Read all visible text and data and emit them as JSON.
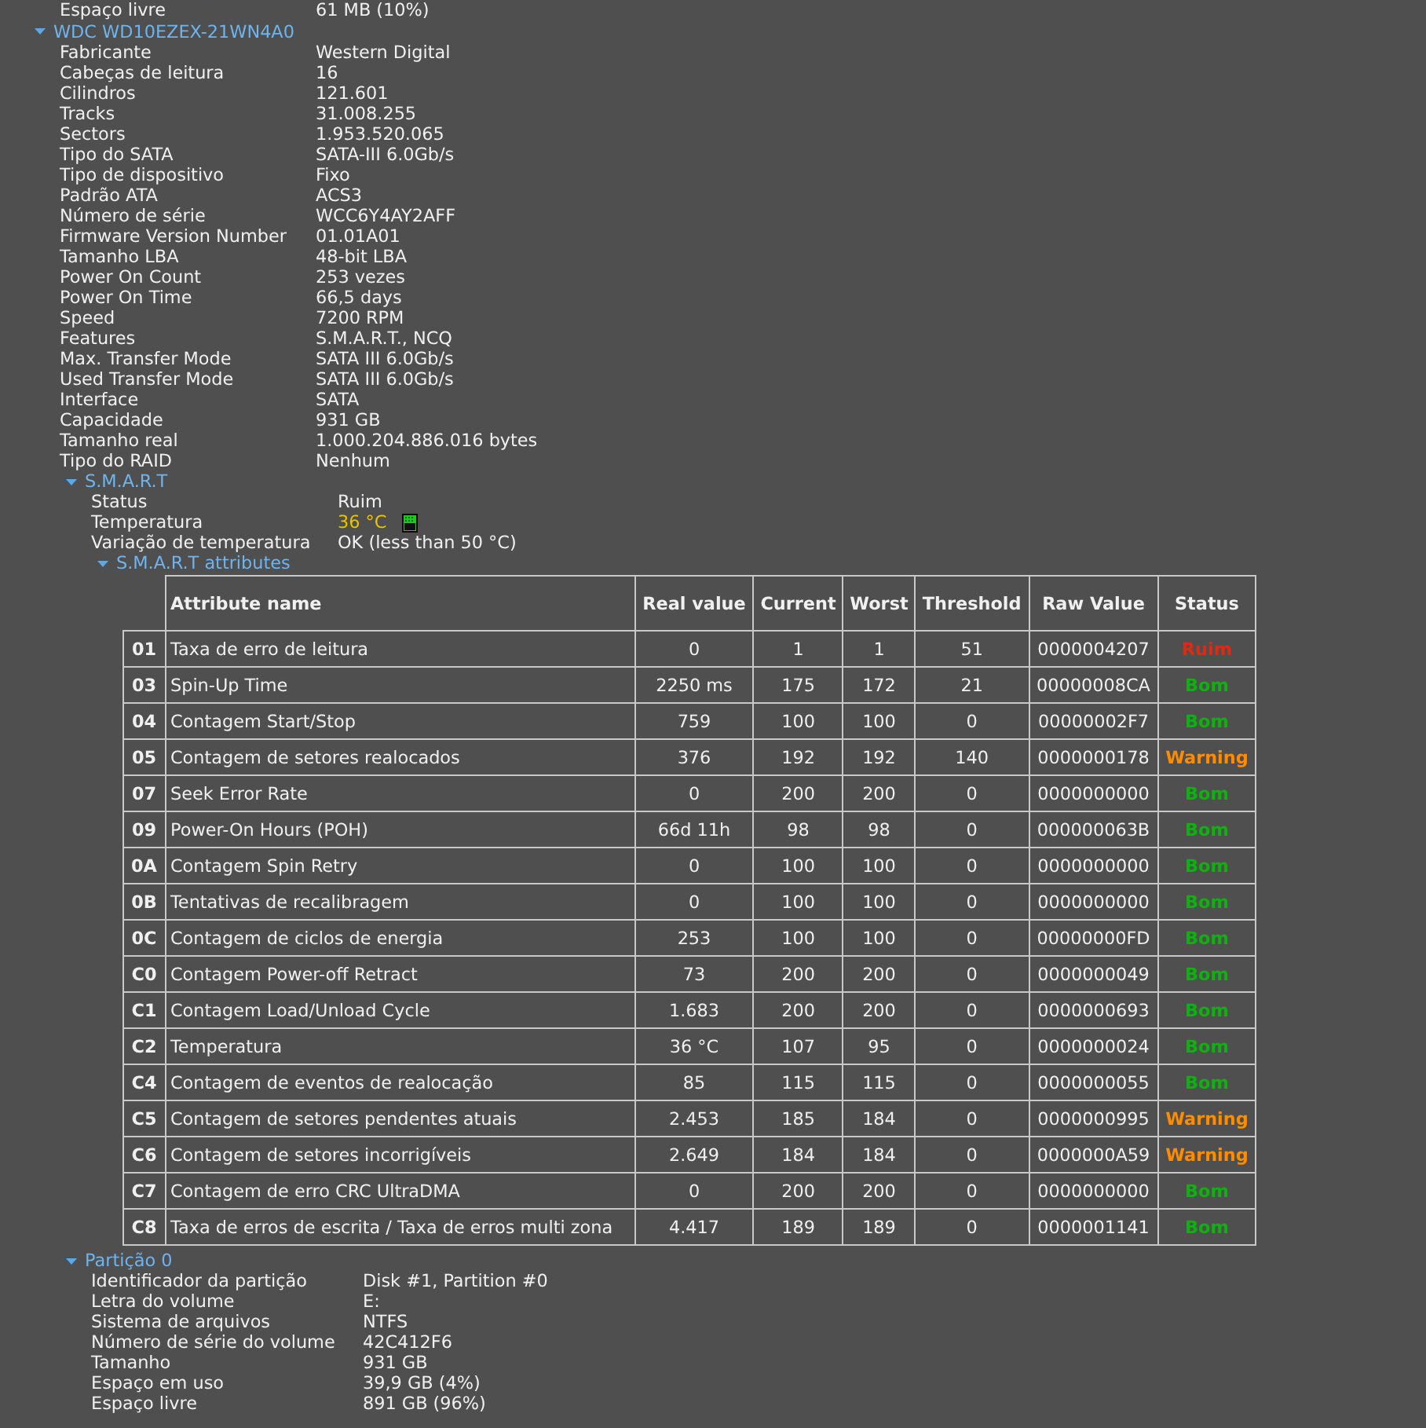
{
  "cut_row": {
    "label": "Espaço livre",
    "value": "61 MB (10%)"
  },
  "disk": {
    "title": "WDC WD10EZEX-21WN4A0",
    "expanded": true,
    "properties": [
      {
        "label": "Fabricante",
        "value": "Western Digital"
      },
      {
        "label": "Cabeças de leitura",
        "value": "16"
      },
      {
        "label": "Cilindros",
        "value": "121.601"
      },
      {
        "label": "Tracks",
        "value": "31.008.255"
      },
      {
        "label": "Sectors",
        "value": "1.953.520.065"
      },
      {
        "label": "Tipo do SATA",
        "value": "SATA-III 6.0Gb/s"
      },
      {
        "label": "Tipo de dispositivo",
        "value": "Fixo"
      },
      {
        "label": "Padrão ATA",
        "value": "ACS3"
      },
      {
        "label": "Número de série",
        "value": "WCC6Y4AY2AFF"
      },
      {
        "label": "Firmware Version Number",
        "value": "01.01A01"
      },
      {
        "label": "Tamanho LBA",
        "value": "48-bit LBA"
      },
      {
        "label": "Power On Count",
        "value": "253 vezes"
      },
      {
        "label": "Power On Time",
        "value": "66,5 days"
      },
      {
        "label": "Speed",
        "value": "7200 RPM"
      },
      {
        "label": "Features",
        "value": "S.M.A.R.T., NCQ"
      },
      {
        "label": "Max. Transfer Mode",
        "value": "SATA III 6.0Gb/s"
      },
      {
        "label": "Used Transfer Mode",
        "value": "SATA III 6.0Gb/s"
      },
      {
        "label": "Interface",
        "value": "SATA"
      },
      {
        "label": "Capacidade",
        "value": "931 GB"
      },
      {
        "label": "Tamanho real",
        "value": "1.000.204.886.016 bytes"
      },
      {
        "label": "Tipo do RAID",
        "value": "Nenhum"
      }
    ]
  },
  "smart": {
    "title": "S.M.A.R.T",
    "expanded": true,
    "items": [
      {
        "label": "Status",
        "value": "Ruim",
        "kind": "text"
      },
      {
        "label": "Temperatura",
        "value": "36 °C",
        "kind": "temperature",
        "color": "#e8c400"
      },
      {
        "label": "Variação de temperatura",
        "value": "OK (less than 50 °C)",
        "kind": "text"
      }
    ],
    "attributes": {
      "title": "S.M.A.R.T attributes",
      "expanded": true,
      "columns": [
        "Attribute name",
        "Real value",
        "Current",
        "Worst",
        "Threshold",
        "Raw Value",
        "Status"
      ],
      "rows": [
        {
          "id": "01",
          "name": "Taxa de erro de leitura",
          "real": "0",
          "current": "1",
          "worst": "1",
          "threshold": "51",
          "raw": "0000004207",
          "status": "Ruim",
          "color": "#e02a10"
        },
        {
          "id": "03",
          "name": "Spin-Up Time",
          "real": "2250 ms",
          "current": "175",
          "worst": "172",
          "threshold": "21",
          "raw": "00000008CA",
          "status": "Bom",
          "color": "#10b010"
        },
        {
          "id": "04",
          "name": "Contagem Start/Stop",
          "real": "759",
          "current": "100",
          "worst": "100",
          "threshold": "0",
          "raw": "00000002F7",
          "status": "Bom",
          "color": "#10b010"
        },
        {
          "id": "05",
          "name": "Contagem de setores realocados",
          "real": "376",
          "current": "192",
          "worst": "192",
          "threshold": "140",
          "raw": "0000000178",
          "status": "Warning",
          "color": "#ff8c00"
        },
        {
          "id": "07",
          "name": "Seek Error Rate",
          "real": "0",
          "current": "200",
          "worst": "200",
          "threshold": "0",
          "raw": "0000000000",
          "status": "Bom",
          "color": "#10b010"
        },
        {
          "id": "09",
          "name": "Power-On Hours (POH)",
          "real": "66d 11h",
          "current": "98",
          "worst": "98",
          "threshold": "0",
          "raw": "000000063B",
          "status": "Bom",
          "color": "#10b010"
        },
        {
          "id": "0A",
          "name": "Contagem Spin Retry",
          "real": "0",
          "current": "100",
          "worst": "100",
          "threshold": "0",
          "raw": "0000000000",
          "status": "Bom",
          "color": "#10b010"
        },
        {
          "id": "0B",
          "name": "Tentativas de recalibragem",
          "real": "0",
          "current": "100",
          "worst": "100",
          "threshold": "0",
          "raw": "0000000000",
          "status": "Bom",
          "color": "#10b010"
        },
        {
          "id": "0C",
          "name": "Contagem de ciclos de energia",
          "real": "253",
          "current": "100",
          "worst": "100",
          "threshold": "0",
          "raw": "00000000FD",
          "status": "Bom",
          "color": "#10b010"
        },
        {
          "id": "C0",
          "name": "Contagem Power-off Retract",
          "real": "73",
          "current": "200",
          "worst": "200",
          "threshold": "0",
          "raw": "0000000049",
          "status": "Bom",
          "color": "#10b010"
        },
        {
          "id": "C1",
          "name": "Contagem Load/Unload Cycle",
          "real": "1.683",
          "current": "200",
          "worst": "200",
          "threshold": "0",
          "raw": "0000000693",
          "status": "Bom",
          "color": "#10b010"
        },
        {
          "id": "C2",
          "name": "Temperatura",
          "real": "36 °C",
          "current": "107",
          "worst": "95",
          "threshold": "0",
          "raw": "0000000024",
          "status": "Bom",
          "color": "#10b010"
        },
        {
          "id": "C4",
          "name": "Contagem de eventos de realocação",
          "real": "85",
          "current": "115",
          "worst": "115",
          "threshold": "0",
          "raw": "0000000055",
          "status": "Bom",
          "color": "#10b010"
        },
        {
          "id": "C5",
          "name": "Contagem de setores pendentes atuais",
          "real": "2.453",
          "current": "185",
          "worst": "184",
          "threshold": "0",
          "raw": "0000000995",
          "status": "Warning",
          "color": "#ff8c00"
        },
        {
          "id": "C6",
          "name": "Contagem de setores incorrigíveis",
          "real": "2.649",
          "current": "184",
          "worst": "184",
          "threshold": "0",
          "raw": "0000000A59",
          "status": "Warning",
          "color": "#ff8c00"
        },
        {
          "id": "C7",
          "name": "Contagem de erro CRC UltraDMA",
          "real": "0",
          "current": "200",
          "worst": "200",
          "threshold": "0",
          "raw": "0000000000",
          "status": "Bom",
          "color": "#10b010"
        },
        {
          "id": "C8",
          "name": "Taxa de erros de escrita / Taxa de erros multi zona",
          "real": "4.417",
          "current": "189",
          "worst": "189",
          "threshold": "0",
          "raw": "0000001141",
          "status": "Bom",
          "color": "#10b010"
        }
      ]
    }
  },
  "partition": {
    "title": "Partição 0",
    "expanded": true,
    "properties": [
      {
        "label": "Identificador da partição",
        "value": "Disk #1, Partition #0"
      },
      {
        "label": "Letra do volume",
        "value": "E:"
      },
      {
        "label": "Sistema de arquivos",
        "value": "NTFS"
      },
      {
        "label": "Número de série do volume",
        "value": "42C412F6"
      },
      {
        "label": "Tamanho",
        "value": "931 GB"
      },
      {
        "label": "Espaço em uso",
        "value": "39,9 GB (4%)"
      },
      {
        "label": "Espaço livre",
        "value": "891 GB (96%)"
      }
    ]
  }
}
